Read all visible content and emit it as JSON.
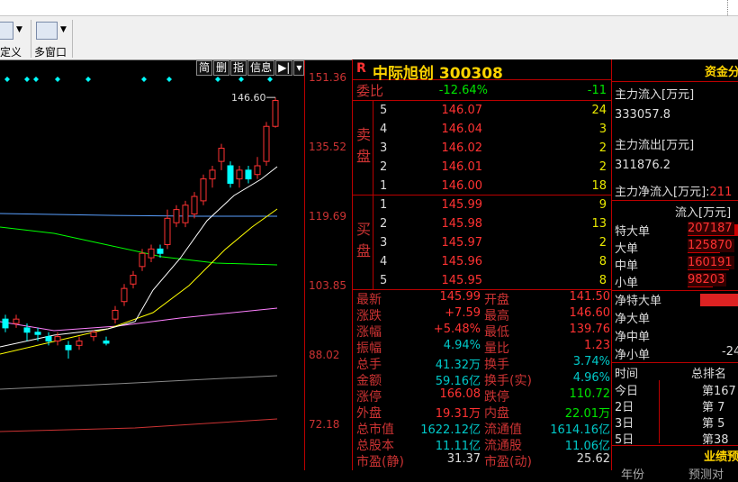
{
  "toolbar": {
    "btn1_label": "自定义",
    "btn2_label": "多窗口"
  },
  "chart": {
    "axis_labels": [
      "151.36",
      "135.52",
      "119.69",
      "103.85",
      "88.02",
      "72.18"
    ],
    "high_marker": "146.60",
    "mini_buttons": [
      "简",
      "删",
      "指",
      "信息"
    ],
    "colors": {
      "up": "#ff3232",
      "down": "#00ffff",
      "ma5": "#ffffff",
      "ma10": "#ffff00",
      "ma20": "#ff80ff",
      "ma60": "#00ff00"
    }
  },
  "quote": {
    "logo": "R",
    "title": "中际旭创 300308",
    "weibi_label": "委比",
    "weibi_pct": "-12.64%",
    "weibi_diff": "-11",
    "sell_label": "卖盘",
    "buy_label": "买盘",
    "sell": [
      {
        "lvl": "5",
        "price": "146.07",
        "vol": "24"
      },
      {
        "lvl": "4",
        "price": "146.04",
        "vol": "3"
      },
      {
        "lvl": "3",
        "price": "146.02",
        "vol": "2"
      },
      {
        "lvl": "2",
        "price": "146.01",
        "vol": "2"
      },
      {
        "lvl": "1",
        "price": "146.00",
        "vol": "18"
      }
    ],
    "buy": [
      {
        "lvl": "1",
        "price": "145.99",
        "vol": "9"
      },
      {
        "lvl": "2",
        "price": "145.98",
        "vol": "13"
      },
      {
        "lvl": "3",
        "price": "145.97",
        "vol": "2"
      },
      {
        "lvl": "4",
        "price": "145.96",
        "vol": "8"
      },
      {
        "lvl": "5",
        "price": "145.95",
        "vol": "8"
      }
    ],
    "stats": [
      {
        "l1": "最新",
        "v1": "145.99",
        "c1": "red",
        "l2": "开盘",
        "v2": "141.50",
        "c2": "red"
      },
      {
        "l1": "涨跌",
        "v1": "+7.59",
        "c1": "red",
        "l2": "最高",
        "v2": "146.60",
        "c2": "red"
      },
      {
        "l1": "涨幅",
        "v1": "+5.48%",
        "c1": "red",
        "l2": "最低",
        "v2": "139.76",
        "c2": "red"
      },
      {
        "l1": "振幅",
        "v1": "4.94%",
        "c1": "cyan",
        "l2": "量比",
        "v2": "1.23",
        "c2": "red"
      },
      {
        "l1": "总手",
        "v1": "41.32万",
        "c1": "cyan",
        "l2": "换手",
        "v2": "3.74%",
        "c2": "cyan"
      },
      {
        "l1": "金额",
        "v1": "59.16亿",
        "c1": "cyan",
        "l2": "换手(实)",
        "v2": "4.96%",
        "c2": "cyan"
      },
      {
        "l1": "涨停",
        "v1": "166.08",
        "c1": "red",
        "l2": "跌停",
        "v2": "110.72",
        "c2": "green"
      },
      {
        "l1": "外盘",
        "v1": "19.31万",
        "c1": "red",
        "l2": "内盘",
        "v2": "22.01万",
        "c2": "green"
      },
      {
        "l1": "总市值",
        "v1": "1622.12亿",
        "c1": "cyan",
        "l2": "流通值",
        "v2": "1614.16亿",
        "c2": "cyan"
      },
      {
        "l1": "总股本",
        "v1": "11.11亿",
        "c1": "cyan",
        "l2": "流通股",
        "v2": "11.06亿",
        "c2": "cyan"
      },
      {
        "l1": "市盈(静)",
        "v1": "31.37",
        "c1": "white",
        "l2": "市盈(动)",
        "v2": "25.62",
        "c2": "white"
      }
    ]
  },
  "right": {
    "header": "资金分",
    "inflow_label": "主力流入[万元]",
    "inflow_val": "333057.8",
    "outflow_label": "主力流出[万元]",
    "outflow_val": "311876.2",
    "net_label": "主力净流入[万元]:",
    "net_val": "211",
    "flow_header": "流入[万元]",
    "flows": [
      {
        "label": "特大单",
        "val": "207187"
      },
      {
        "label": "大单",
        "val": "125870"
      },
      {
        "label": "中单",
        "val": "160191"
      },
      {
        "label": "小单",
        "val": "98203"
      }
    ],
    "nets": [
      "净特大单",
      "净大单",
      "净中单",
      "净小单"
    ],
    "net_small_val": "-24",
    "time_label": "时间",
    "rank_label": "总排名",
    "days": [
      {
        "d": "今日",
        "r": "第167"
      },
      {
        "d": "2日",
        "r": "第 7"
      },
      {
        "d": "3日",
        "r": "第 5"
      },
      {
        "d": "5日",
        "r": "第38"
      }
    ],
    "footer": "业绩预",
    "footer2a": "年份",
    "footer2b": "预测对"
  }
}
